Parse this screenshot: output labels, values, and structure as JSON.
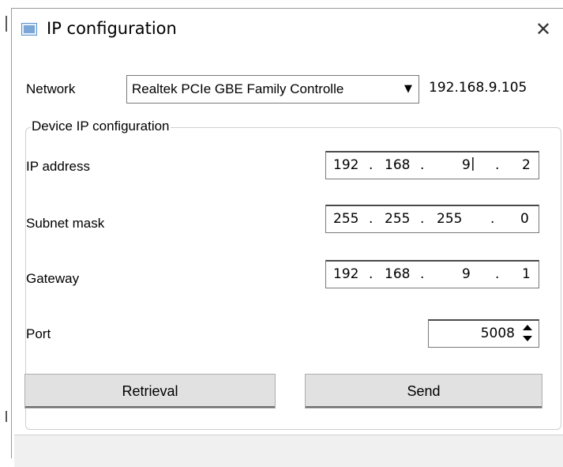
{
  "window": {
    "title": "IP configuration",
    "close_glyph": "✕"
  },
  "network": {
    "label": "Network",
    "adapter": "Realtek PCIe GBE Family Controlle",
    "dropdown_glyph": "▼",
    "host_ip": "192.168.9.105"
  },
  "device": {
    "group_title": "Device IP configuration",
    "ip_label": "IP address",
    "ip": [
      "192",
      "168",
      "9",
      "2"
    ],
    "mask_label": "Subnet mask",
    "mask": [
      "255",
      "255",
      "255",
      "0"
    ],
    "gateway_label": "Gateway",
    "gateway": [
      "192",
      "168",
      "9",
      "1"
    ],
    "port_label": "Port",
    "port": "5008"
  },
  "buttons": {
    "retrieval": "Retrieval",
    "send": "Send"
  },
  "icons": [
    "app-window-icon",
    "close-icon",
    "dropdown-arrow-icon",
    "spin-up-icon",
    "spin-down-icon"
  ]
}
